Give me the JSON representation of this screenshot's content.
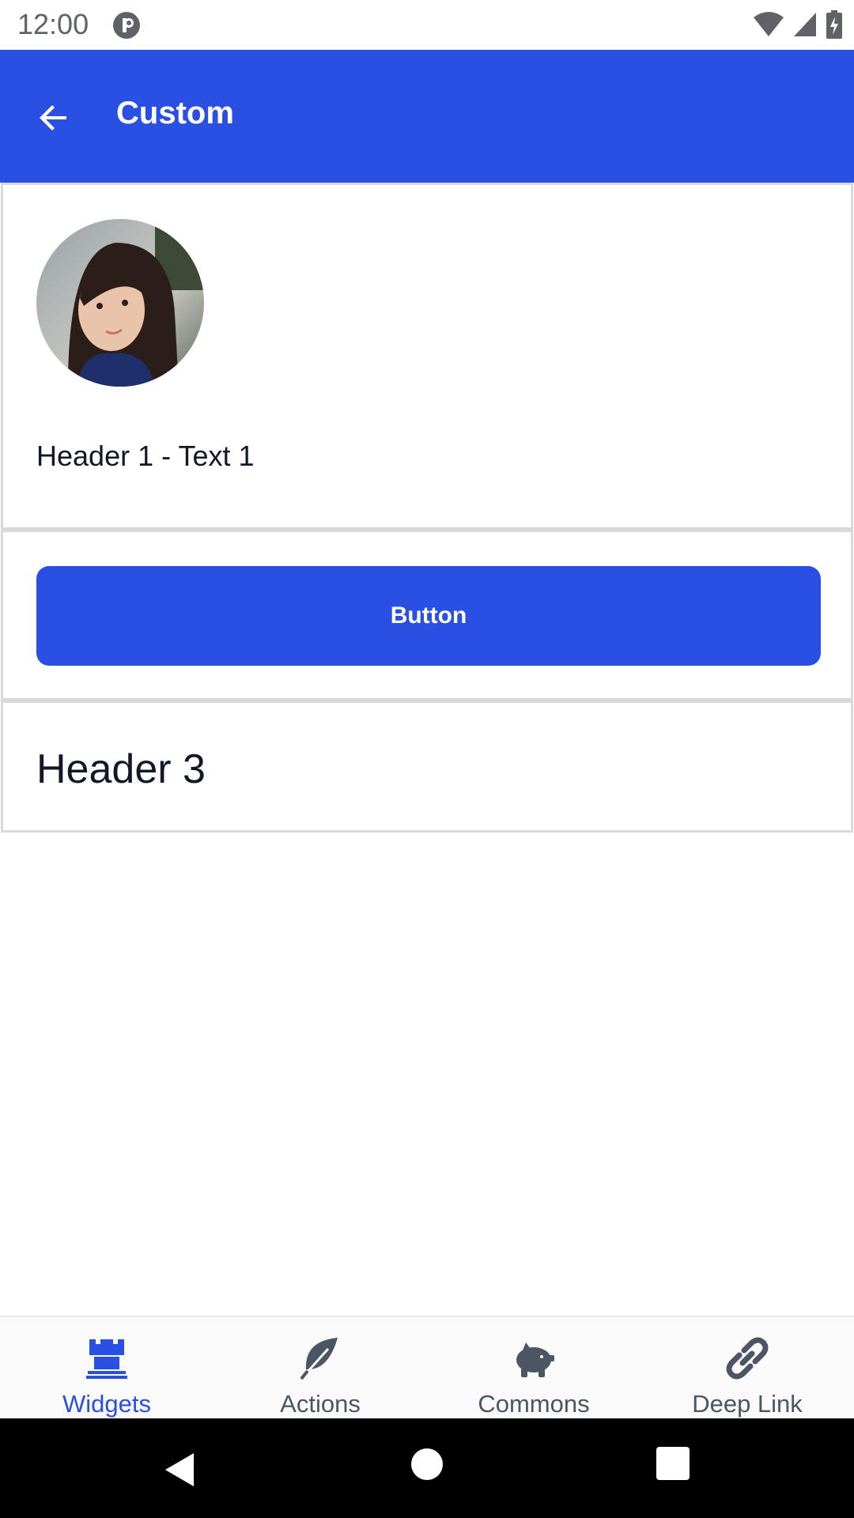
{
  "status_bar": {
    "time": "12:00"
  },
  "app_bar": {
    "title": "Custom",
    "back_icon": "arrow-back-icon"
  },
  "cards": {
    "card1": {
      "avatar_icon": "avatar-photo",
      "text": "Header 1 - Text 1"
    },
    "card2": {
      "button_label": "Button"
    },
    "card3": {
      "heading": "Header 3"
    }
  },
  "bottom_nav": {
    "items": [
      {
        "label": "Widgets",
        "icon": "castle-rook-icon",
        "active": true
      },
      {
        "label": "Actions",
        "icon": "leaf-icon",
        "active": false
      },
      {
        "label": "Commons",
        "icon": "piggy-bank-icon",
        "active": false
      },
      {
        "label": "Deep Link",
        "icon": "link-icon",
        "active": false
      }
    ]
  },
  "colors": {
    "primary": "#2a4fe3",
    "text_dark": "#111827",
    "nav_inactive": "#4b5563",
    "border": "#d9d9d9"
  }
}
